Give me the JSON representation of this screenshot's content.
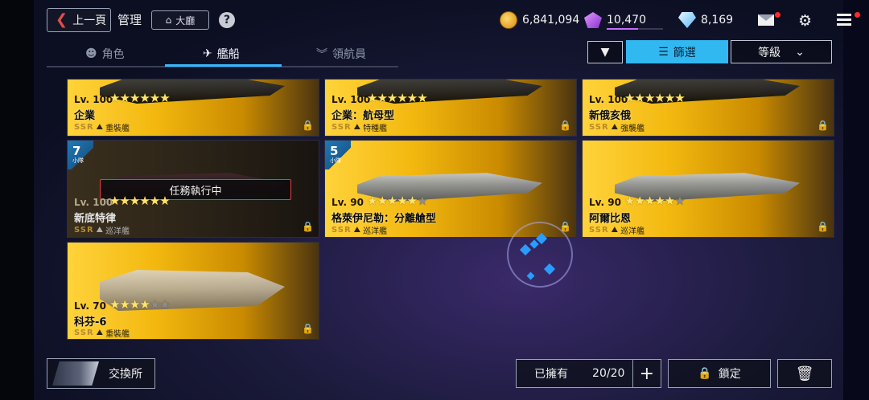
{
  "header": {
    "back_label": "上一頁",
    "title": "管理",
    "lobby_label": "大廳",
    "help_label": "?"
  },
  "resources": {
    "coins": "6,841,094",
    "crystals": "10,470",
    "crystal_bar_fraction": 0.56,
    "diamonds": "8,169"
  },
  "tabs": [
    {
      "label": "角色",
      "icon": "character-icon",
      "active": false
    },
    {
      "label": "艦船",
      "icon": "ship-icon",
      "active": true
    },
    {
      "label": "領航員",
      "icon": "navigator-icon",
      "active": false
    }
  ],
  "filters": {
    "filter_label": "篩選",
    "sort_label": "等級"
  },
  "ships": [
    {
      "level": "Lv. 100",
      "stars": 6,
      "name": "企業",
      "grade": "SSR",
      "class": "重裝艦",
      "locked": true
    },
    {
      "level": "Lv. 100",
      "stars": 6,
      "name": "企業：航母型",
      "grade": "SSR",
      "class": "特種艦",
      "locked": true
    },
    {
      "level": "Lv. 100",
      "stars": 6,
      "name": "新俄亥俄",
      "grade": "SSR",
      "class": "強襲艦",
      "locked": true
    },
    {
      "level": "Lv. 100",
      "stars": 6,
      "name": "新底特律",
      "grade": "SSR",
      "class": "巡洋艦",
      "locked": true,
      "squad": "7",
      "squad_label": "小隊",
      "mission": "任務執行中"
    },
    {
      "level": "Lv. 90",
      "stars": 5,
      "name": "格萊伊尼勒：分離艙型",
      "grade": "SSR",
      "class": "巡洋艦",
      "locked": true,
      "squad": "5",
      "squad_label": "小隊"
    },
    {
      "level": "Lv. 90",
      "stars": 5,
      "name": "阿爾比恩",
      "grade": "SSR",
      "class": "巡洋艦",
      "locked": true
    },
    {
      "level": "Lv. 70",
      "stars": 4,
      "name": "科芬-6",
      "grade": "SSR",
      "class": "重裝艦",
      "locked": true
    }
  ],
  "footer": {
    "exchange_label": "交換所",
    "owned_label": "已擁有",
    "owned_count": "20/20",
    "lock_label": "鎖定"
  },
  "colors": {
    "accent": "#32b8f0",
    "card_gold": "#f3b80f",
    "notification": "#ff2a2a",
    "mission_border": "#e04040"
  }
}
